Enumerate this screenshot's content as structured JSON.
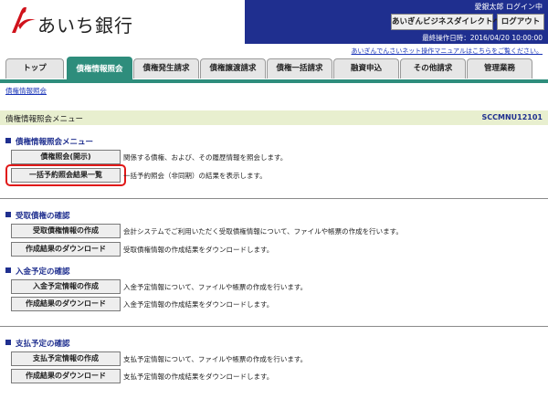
{
  "header": {
    "bank_name": "あいち銀行",
    "user": "愛銀太郎 ログイン中",
    "business_direct_label": "あいぎんビジネスダイレクトへ戻る",
    "logout_label": "ログアウト",
    "last_operation": "最終操作日時：2016/04/20 10:00:00",
    "manual_link": "あいぎんでんさいネット操作マニュアルはこちらをご覧ください。"
  },
  "tabs": [
    {
      "label": "トップ"
    },
    {
      "label": "債権情報照会"
    },
    {
      "label": "債権発生請求"
    },
    {
      "label": "債権譲渡請求"
    },
    {
      "label": "債権一括請求"
    },
    {
      "label": "融資申込"
    },
    {
      "label": "その他請求"
    },
    {
      "label": "管理業務"
    }
  ],
  "breadcrumb": "債権情報照会",
  "page": {
    "title": "債権情報照会メニュー",
    "screen_id": "SCCMNU12101"
  },
  "sections": [
    {
      "title": "債権情報照会メニュー",
      "items": [
        {
          "button": "債権照会(開示)",
          "desc": "関係する債権、および、その履歴情報を照会します。"
        },
        {
          "button": "一括予約照会結果一覧",
          "desc": "一括予約照会（非同期）の結果を表示します。"
        }
      ]
    },
    {
      "title": "受取債権の確認",
      "items": [
        {
          "button": "受取債権情報の作成",
          "desc": "会計システムでご利用いただく受取債権情報について、ファイルや帳票の作成を行います。"
        },
        {
          "button": "作成結果のダウンロード",
          "desc": "受取債権情報の作成結果をダウンロードします。"
        }
      ]
    },
    {
      "title": "入金予定の確認",
      "items": [
        {
          "button": "入金予定情報の作成",
          "desc": "入金予定情報について、ファイルや帳票の作成を行います。"
        },
        {
          "button": "作成結果のダウンロード",
          "desc": "入金予定情報の作成結果をダウンロードします。"
        }
      ]
    },
    {
      "title": "支払予定の確認",
      "items": [
        {
          "button": "支払予定情報の作成",
          "desc": "支払予定情報について、ファイルや帳票の作成を行います。"
        },
        {
          "button": "作成結果のダウンロード",
          "desc": "支払予定情報の作成結果をダウンロードします。"
        }
      ]
    }
  ],
  "colors": {
    "brand_blue": "#1f2f8f",
    "tab_active": "#2e8d7c",
    "band": "#e8efcf",
    "highlight": "#e01818",
    "logo_red": "#d0121b"
  }
}
